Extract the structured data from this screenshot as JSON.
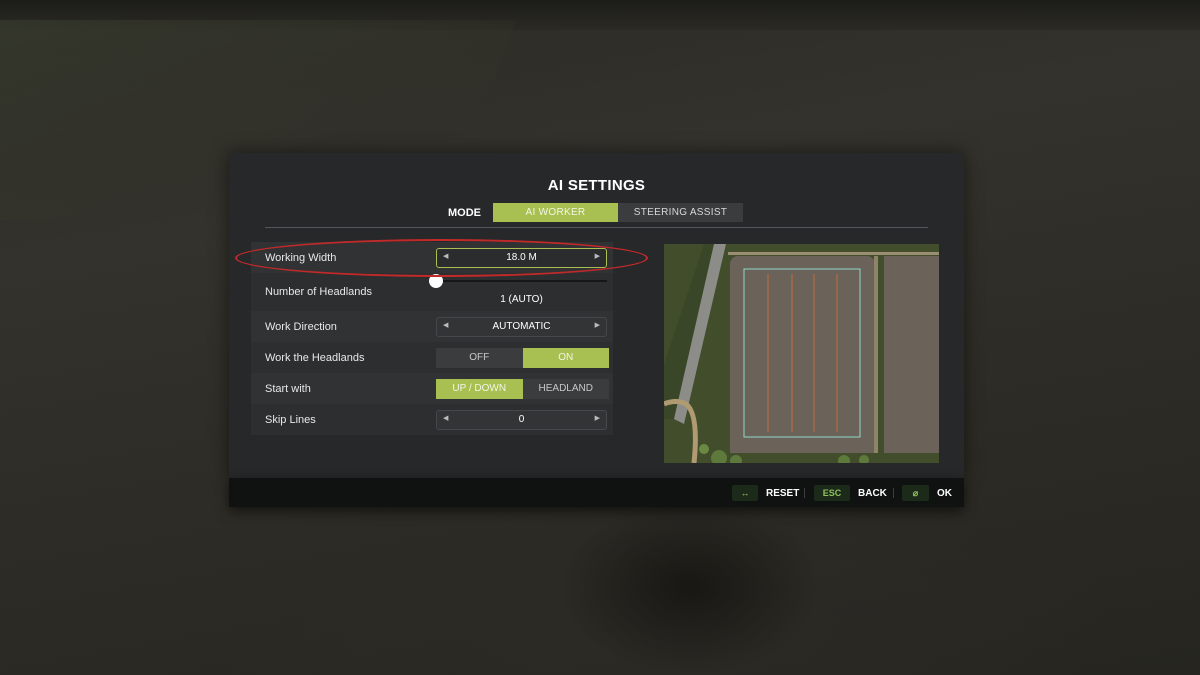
{
  "dialog": {
    "title": "AI SETTINGS",
    "mode_label": "MODE",
    "mode_tabs": [
      "AI WORKER",
      "STEERING ASSIST"
    ],
    "mode_active": "AI WORKER"
  },
  "settings": {
    "working_width": {
      "label": "Working Width",
      "value": "18.0 M"
    },
    "headlands": {
      "label": "Number of Headlands",
      "value": "1 (AUTO)",
      "level": 0
    },
    "work_direction": {
      "label": "Work Direction",
      "value": "AUTOMATIC"
    },
    "work_headlands": {
      "label": "Work the Headlands",
      "options": [
        "OFF",
        "ON"
      ],
      "selected": "ON"
    },
    "start_with": {
      "label": "Start with",
      "options": [
        "UP / DOWN",
        "HEADLAND"
      ],
      "selected": "UP / DOWN"
    },
    "skip_lines": {
      "label": "Skip Lines",
      "value": "0"
    }
  },
  "footer": {
    "reset": {
      "key": "↔",
      "label": "RESET"
    },
    "back": {
      "key": "ESC",
      "label": "BACK"
    },
    "ok": {
      "key": "⌀",
      "label": "OK"
    }
  },
  "colors": {
    "accent": "#a8bf52",
    "highlight_ring": "#c22a2a",
    "panel": "#26282a"
  }
}
